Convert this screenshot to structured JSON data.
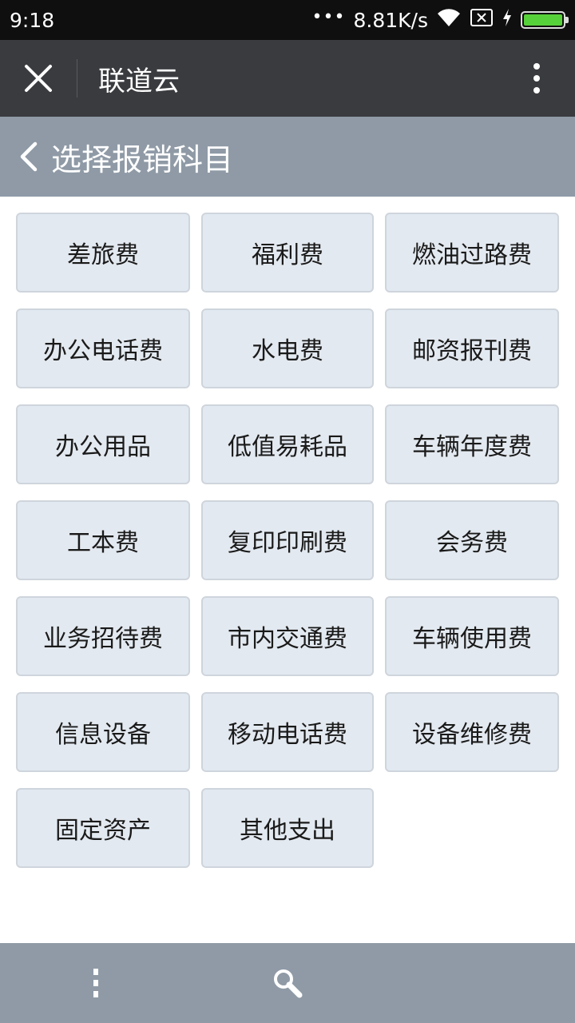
{
  "status": {
    "time": "9:18",
    "dots": "•••",
    "network_speed": "8.81K/s",
    "icons": [
      "wifi-icon",
      "sim-disabled-icon",
      "charging-icon",
      "battery-icon"
    ],
    "battery_percent": 100
  },
  "appbar": {
    "title": "联道云",
    "close_icon": "close-icon",
    "more_icon": "more-vertical-icon"
  },
  "subheader": {
    "title": "选择报销科目",
    "back_icon": "chevron-left-icon"
  },
  "categories": [
    "差旅费",
    "福利费",
    "燃油过路费",
    "办公电话费",
    "水电费",
    "邮资报刊费",
    "办公用品",
    "低值易耗品",
    "车辆年度费",
    "工本费",
    "复印印刷费",
    "会务费",
    "业务招待费",
    "市内交通费",
    "车辆使用费",
    "信息设备",
    "移动电话费",
    "设备维修费",
    "固定资产",
    "其他支出"
  ],
  "bottombar": {
    "icons": [
      "vertical-menu-icon",
      "search-icon"
    ]
  },
  "colors": {
    "statusbar_bg": "#0f0f0f",
    "appbar_bg": "#3a3b3f",
    "subheader_bg": "#8f9aa6",
    "cell_bg": "#e3e9f0",
    "cell_border": "#cfd5dc",
    "battery_fill": "#57d13a"
  }
}
